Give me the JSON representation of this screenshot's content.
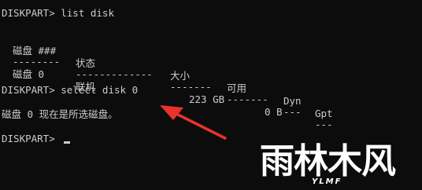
{
  "console": {
    "line1": "DISKPART> list disk",
    "table": {
      "headers": [
        "磁盘 ###",
        "状态",
        "大小",
        "可用",
        "Dyn",
        "Gpt"
      ],
      "separators": [
        "--------",
        "-------------",
        "-------",
        "-------",
        "---",
        "---"
      ],
      "rows": [
        {
          "disk": "磁盘 0",
          "status": "联机",
          "size": "223 GB",
          "free": "0 B",
          "dyn": "",
          "gpt": ""
        }
      ]
    },
    "line_select": "DISKPART> select disk 0",
    "line_result": "磁盘 0 现在是所选磁盘。",
    "line_prompt": "DISKPART> "
  },
  "annotation": {
    "arrow_color": "#e8332a"
  },
  "watermark": {
    "main_text": "雨林木风",
    "sub_text": "YLMF"
  }
}
